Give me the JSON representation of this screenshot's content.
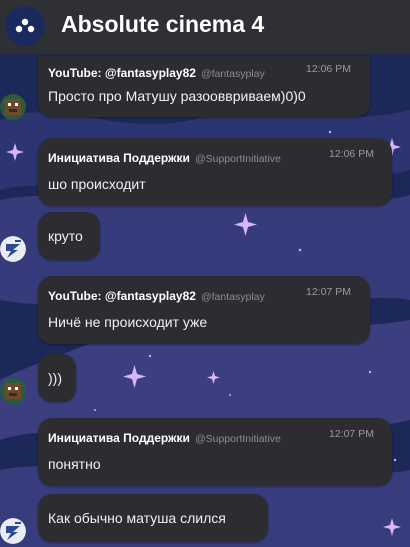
{
  "chat": {
    "title": "Absolute cinema 4",
    "colors": {
      "header": "#2f3034",
      "bubble": "#2d2c30",
      "accent_bg": "#1d2a5b"
    }
  },
  "messages": [
    {
      "sender": "YouTube: @fantasyplay82",
      "handle": "@fantasyplay",
      "time": "12:06 PM",
      "text": "Просто про Матушу разооввриваем)0)0"
    },
    {
      "sender": "Инициатива Поддержки",
      "handle": "@SupportInitiative",
      "time": "12:06 PM",
      "text": "шо происходит"
    },
    {
      "text": "круто"
    },
    {
      "sender": "YouTube: @fantasyplay82",
      "handle": "@fantasyplay",
      "time": "12:07 PM",
      "text": "Ничё не происходит уже"
    },
    {
      "text": ")))"
    },
    {
      "sender": "Инициатива Поддержки",
      "handle": "@SupportInitiative",
      "time": "12:07 PM",
      "text": "понятно"
    },
    {
      "text": "Как обычно матуша слился"
    }
  ]
}
